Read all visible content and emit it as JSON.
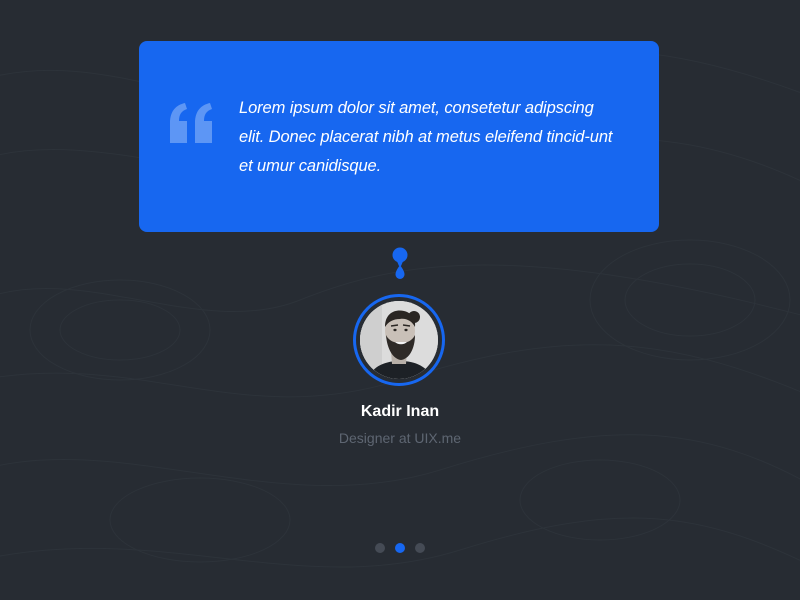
{
  "testimonial": {
    "quote": "Lorem ipsum dolor sit amet, consetetur adipscing elit. Donec placerat nibh at metus eleifend tincid-unt et umur canidisque.",
    "author_name": "Kadir Inan",
    "author_role": "Designer at UIX.me"
  },
  "icons": {
    "quote": "quote-icon",
    "connector": "connector-icon",
    "avatar": "avatar-photo"
  },
  "pager": {
    "count": 3,
    "active_index": 1
  },
  "colors": {
    "background": "#272c33",
    "accent": "#1767f0",
    "name_text": "#ffffff",
    "role_text": "#5e6672",
    "dot_inactive": "#454b55"
  }
}
